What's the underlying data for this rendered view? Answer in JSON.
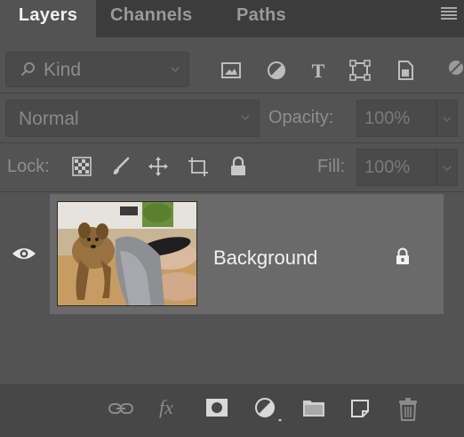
{
  "tabs": [
    {
      "label": "Layers",
      "active": true
    },
    {
      "label": "Channels",
      "active": false
    },
    {
      "label": "Paths",
      "active": false
    }
  ],
  "filter": {
    "kind_label": "Kind",
    "icons": [
      "image-filter-icon",
      "adjustment-filter-icon",
      "type-filter-icon",
      "shape-filter-icon",
      "smart-object-filter-icon",
      "filter-toggle-icon"
    ]
  },
  "blend": {
    "mode": "Normal",
    "opacity_label": "Opacity:",
    "opacity_value": "100%"
  },
  "lock": {
    "label": "Lock:",
    "icons": [
      "lock-transparent-pixels-icon",
      "lock-image-pixels-icon",
      "lock-position-icon",
      "lock-artboard-icon",
      "lock-all-icon"
    ],
    "fill_label": "Fill:",
    "fill_value": "100%"
  },
  "layers": [
    {
      "name": "Background",
      "visible": true,
      "locked": true
    }
  ],
  "bottom_toolbar": {
    "icons": [
      "link-layers-icon",
      "fx-icon",
      "layer-mask-icon",
      "adjustment-layer-icon",
      "new-group-icon",
      "new-layer-icon",
      "trash-icon"
    ],
    "fx_label": "fx"
  },
  "colors": {
    "panel_bg": "#535353",
    "tabbar_bg": "#3c3c3c",
    "selected_row": "#6a6a6a",
    "text_active": "#f0f0f0"
  }
}
